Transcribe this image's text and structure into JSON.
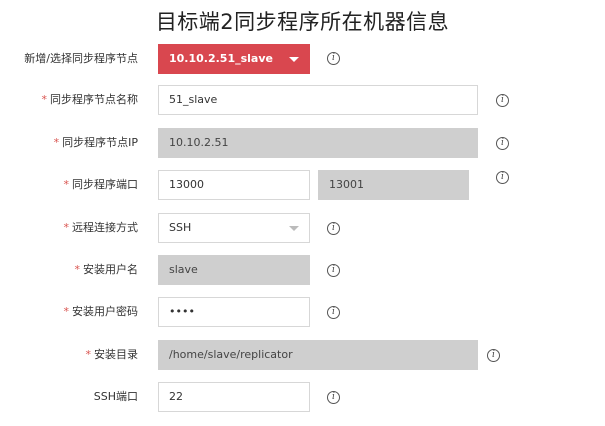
{
  "page_title": "目标端2同步程序所在机器信息",
  "colors": {
    "accent_select": "#d9474f",
    "required": "#d9534f",
    "readonly_bg": "#cfcfcf"
  },
  "fields": {
    "node_select": {
      "label": "新增/选择同步程序节点",
      "value": "10.10.2.51_slave",
      "icon": "chevron-down-icon"
    },
    "node_name": {
      "required": "*",
      "label": "同步程序节点名称",
      "value": "51_slave"
    },
    "node_ip": {
      "required": "*",
      "label": "同步程序节点IP",
      "value": "10.10.2.51"
    },
    "node_port": {
      "required": "*",
      "label": "同步程序端口",
      "value": "13000",
      "value2": "13001"
    },
    "remote_method": {
      "required": "*",
      "label": "远程连接方式",
      "value": "SSH",
      "icon": "chevron-down-icon"
    },
    "install_user": {
      "required": "*",
      "label": "安装用户名",
      "value": "slave"
    },
    "install_password": {
      "required": "*",
      "label": "安装用户密码",
      "value": "••••"
    },
    "install_dir": {
      "required": "*",
      "label": "安装目录",
      "value": "/home/slave/replicator"
    },
    "ssh_port": {
      "label": "SSH端口",
      "value": "22"
    }
  },
  "info_icon": "i"
}
